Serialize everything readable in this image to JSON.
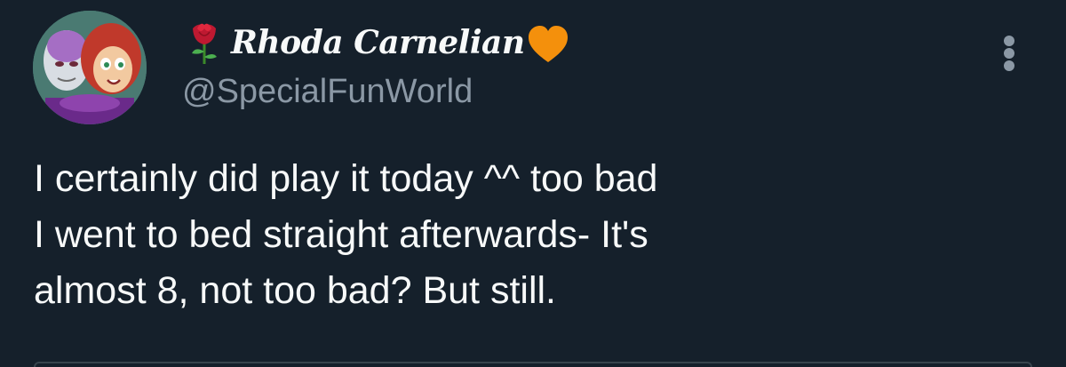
{
  "author": {
    "display_name": "Rhoda Carnelian",
    "handle": "@SpecialFunWorld",
    "name_prefix_icon": "rose-icon",
    "name_suffix_icon": "orange-heart-icon",
    "avatar_description_icon": "avatar"
  },
  "tweet": {
    "lines": [
      "I certainly did play it today ^^ too bad",
      "I went to bed straight afterwards- It's",
      "almost 8, not too bad? But still."
    ]
  },
  "actions": {
    "more_icon": "more-vertical-icon"
  },
  "colors": {
    "background": "#15202b",
    "text_primary": "#f7f9f9",
    "text_secondary": "#8b98a5",
    "heart": "#f4900c",
    "rose": "#be1931"
  }
}
